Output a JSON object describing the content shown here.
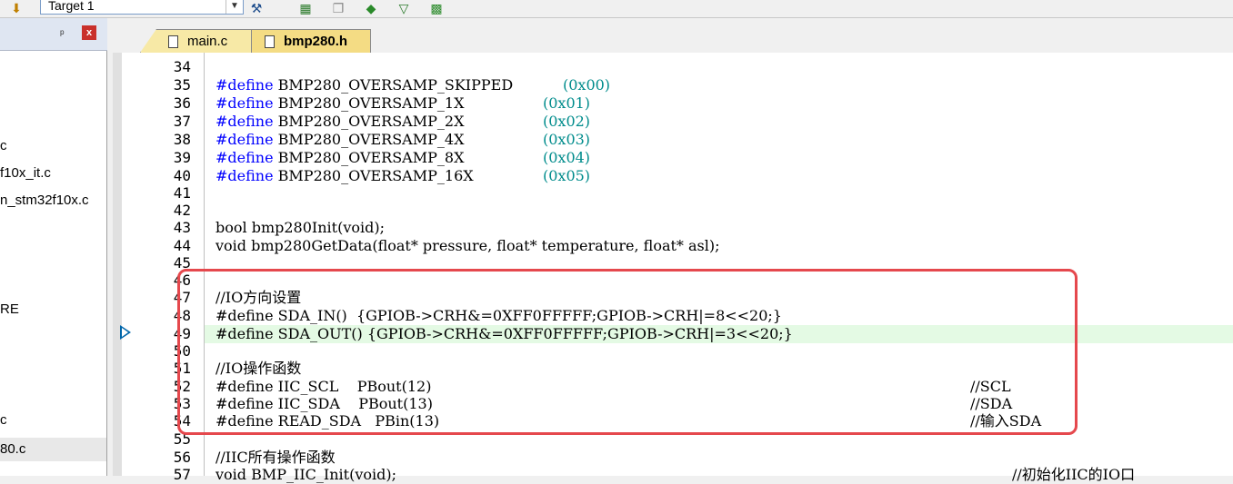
{
  "toolbar": {
    "target_value": "Target 1",
    "icons": [
      "build-target-icon",
      "dropdown-arrow-icon",
      "options-icon",
      "manage-icon",
      "copy-icon",
      "pack-icon",
      "filter-icon",
      "debug-icon"
    ]
  },
  "project_panel": {
    "pin": "ᵖ",
    "close": "x",
    "items": [
      "c",
      "f10x_it.c",
      "n_stm32f10x.c",
      "RE",
      "c",
      "80.c"
    ]
  },
  "tabs": [
    {
      "label": "main.c"
    },
    {
      "label": "bmp280.h"
    }
  ],
  "editor": {
    "line_numbers": [
      "34",
      "35",
      "36",
      "37",
      "38",
      "39",
      "40",
      "41",
      "42",
      "43",
      "44",
      "45",
      "46",
      "47",
      "48",
      "49",
      "50",
      "51",
      "52",
      "53",
      "54",
      "55",
      "56",
      "57"
    ],
    "lines": [
      {
        "ln": "34",
        "text": ""
      },
      {
        "ln": "35",
        "directive": "#define",
        "name": "BMP280_OVERSAMP_SKIPPED",
        "value": "(0x00)"
      },
      {
        "ln": "36",
        "directive": "#define",
        "name": "BMP280_OVERSAMP_1X",
        "value": "(0x01)"
      },
      {
        "ln": "37",
        "directive": "#define",
        "name": "BMP280_OVERSAMP_2X",
        "value": "(0x02)"
      },
      {
        "ln": "38",
        "directive": "#define",
        "name": "BMP280_OVERSAMP_4X",
        "value": "(0x03)"
      },
      {
        "ln": "39",
        "directive": "#define",
        "name": "BMP280_OVERSAMP_8X",
        "value": "(0x04)"
      },
      {
        "ln": "40",
        "directive": "#define",
        "name": "BMP280_OVERSAMP_16X",
        "value": "(0x05)"
      },
      {
        "ln": "43",
        "code": "bool bmp280Init(void);"
      },
      {
        "ln": "44",
        "code": "void bmp280GetData(float* pressure, float* temperature, float* asl);"
      },
      {
        "ln": "47",
        "comment": "//IO方向设置"
      },
      {
        "ln": "48",
        "code": "#define SDA_IN()  {GPIOB->CRH&=0XFF0FFFFF;GPIOB->CRH|=8<<20;}"
      },
      {
        "ln": "49",
        "code": "#define SDA_OUT() {GPIOB->CRH&=0XFF0FFFFF;GPIOB->CRH|=3<<20;}"
      },
      {
        "ln": "51",
        "comment": "//IO操作函数"
      },
      {
        "ln": "52",
        "code": "#define IIC_SCL    PBout(12)",
        "trail": "//SCL"
      },
      {
        "ln": "53",
        "code": "#define IIC_SDA    PBout(13)",
        "trail": "//SDA"
      },
      {
        "ln": "54",
        "code": "#define READ_SDA   PBin(13)",
        "trail": "//输入SDA"
      },
      {
        "ln": "56",
        "comment": "//IIC所有操作函数"
      },
      {
        "ln": "57",
        "code": "void BMP_IIC_Init(void);",
        "trail": "//初始化IIC的IO口"
      }
    ]
  },
  "colors": {
    "keyword": "#0000ff",
    "number": "#008c8c",
    "comment": "#008000",
    "highlight_line": "#e4fae4",
    "annotation_box": "#e5484d"
  }
}
